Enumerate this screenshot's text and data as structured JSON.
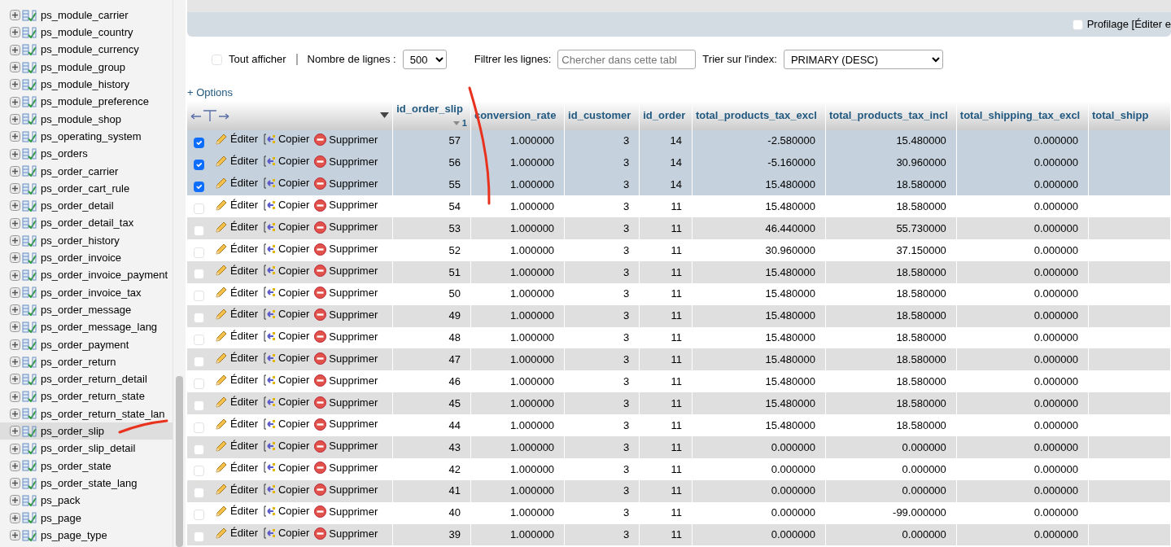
{
  "sidebar": {
    "items": [
      {
        "label": "ps_module_carrier",
        "selected": false
      },
      {
        "label": "ps_module_country",
        "selected": false
      },
      {
        "label": "ps_module_currency",
        "selected": false
      },
      {
        "label": "ps_module_group",
        "selected": false
      },
      {
        "label": "ps_module_history",
        "selected": false
      },
      {
        "label": "ps_module_preference",
        "selected": false
      },
      {
        "label": "ps_module_shop",
        "selected": false
      },
      {
        "label": "ps_operating_system",
        "selected": false
      },
      {
        "label": "ps_orders",
        "selected": false
      },
      {
        "label": "ps_order_carrier",
        "selected": false
      },
      {
        "label": "ps_order_cart_rule",
        "selected": false
      },
      {
        "label": "ps_order_detail",
        "selected": false
      },
      {
        "label": "ps_order_detail_tax",
        "selected": false
      },
      {
        "label": "ps_order_history",
        "selected": false
      },
      {
        "label": "ps_order_invoice",
        "selected": false
      },
      {
        "label": "ps_order_invoice_payment",
        "selected": false
      },
      {
        "label": "ps_order_invoice_tax",
        "selected": false
      },
      {
        "label": "ps_order_message",
        "selected": false
      },
      {
        "label": "ps_order_message_lang",
        "selected": false
      },
      {
        "label": "ps_order_payment",
        "selected": false
      },
      {
        "label": "ps_order_return",
        "selected": false
      },
      {
        "label": "ps_order_return_detail",
        "selected": false
      },
      {
        "label": "ps_order_return_state",
        "selected": false
      },
      {
        "label": "ps_order_return_state_lan",
        "selected": false
      },
      {
        "label": "ps_order_slip",
        "selected": true
      },
      {
        "label": "ps_order_slip_detail",
        "selected": false
      },
      {
        "label": "ps_order_state",
        "selected": false
      },
      {
        "label": "ps_order_state_lang",
        "selected": false
      },
      {
        "label": "ps_pack",
        "selected": false
      },
      {
        "label": "ps_page",
        "selected": false
      },
      {
        "label": "ps_page_type",
        "selected": false
      }
    ]
  },
  "profiling": {
    "checked": false,
    "label": "Profilage [",
    "link": "Éditer e"
  },
  "controls": {
    "show_all": {
      "checked": false,
      "label": "Tout afficher"
    },
    "rows_label": "Nombre de lignes :",
    "rows_value": "500",
    "filter_label": "Filtrer les lignes:",
    "filter_placeholder": "Chercher dans cette tabl",
    "sort_label": "Trier sur l'index:",
    "sort_value": "PRIMARY (DESC)"
  },
  "options_link": "+ Options",
  "table": {
    "columns": [
      {
        "label": "id_order_slip",
        "sort_number": "1"
      },
      {
        "label": "conversion_rate"
      },
      {
        "label": "id_customer"
      },
      {
        "label": "id_order"
      },
      {
        "label": "total_products_tax_excl"
      },
      {
        "label": "total_products_tax_incl"
      },
      {
        "label": "total_shipping_tax_excl"
      },
      {
        "label": "total_shipp"
      }
    ],
    "rows": [
      {
        "selected": true,
        "edit": "Éditer",
        "copy": "Copier",
        "delete": "Supprimer",
        "cells": [
          "57",
          "1.000000",
          "3",
          "14",
          "-2.580000",
          "15.480000",
          "0.000000"
        ]
      },
      {
        "selected": true,
        "edit": "Éditer",
        "copy": "Copier",
        "delete": "Supprimer",
        "cells": [
          "56",
          "1.000000",
          "3",
          "14",
          "-5.160000",
          "30.960000",
          "0.000000"
        ]
      },
      {
        "selected": true,
        "edit": "Éditer",
        "copy": "Copier",
        "delete": "Supprimer",
        "cells": [
          "55",
          "1.000000",
          "3",
          "14",
          "15.480000",
          "18.580000",
          "0.000000"
        ]
      },
      {
        "selected": false,
        "edit": "Éditer",
        "copy": "Copier",
        "delete": "Supprimer",
        "cells": [
          "54",
          "1.000000",
          "3",
          "11",
          "15.480000",
          "18.580000",
          "0.000000"
        ]
      },
      {
        "selected": false,
        "edit": "Éditer",
        "copy": "Copier",
        "delete": "Supprimer",
        "cells": [
          "53",
          "1.000000",
          "3",
          "11",
          "46.440000",
          "55.730000",
          "0.000000"
        ]
      },
      {
        "selected": false,
        "edit": "Éditer",
        "copy": "Copier",
        "delete": "Supprimer",
        "cells": [
          "52",
          "1.000000",
          "3",
          "11",
          "30.960000",
          "37.150000",
          "0.000000"
        ]
      },
      {
        "selected": false,
        "edit": "Éditer",
        "copy": "Copier",
        "delete": "Supprimer",
        "cells": [
          "51",
          "1.000000",
          "3",
          "11",
          "15.480000",
          "18.580000",
          "0.000000"
        ]
      },
      {
        "selected": false,
        "edit": "Éditer",
        "copy": "Copier",
        "delete": "Supprimer",
        "cells": [
          "50",
          "1.000000",
          "3",
          "11",
          "15.480000",
          "18.580000",
          "0.000000"
        ]
      },
      {
        "selected": false,
        "edit": "Éditer",
        "copy": "Copier",
        "delete": "Supprimer",
        "cells": [
          "49",
          "1.000000",
          "3",
          "11",
          "15.480000",
          "18.580000",
          "0.000000"
        ]
      },
      {
        "selected": false,
        "edit": "Éditer",
        "copy": "Copier",
        "delete": "Supprimer",
        "cells": [
          "48",
          "1.000000",
          "3",
          "11",
          "15.480000",
          "18.580000",
          "0.000000"
        ]
      },
      {
        "selected": false,
        "edit": "Éditer",
        "copy": "Copier",
        "delete": "Supprimer",
        "cells": [
          "47",
          "1.000000",
          "3",
          "11",
          "15.480000",
          "18.580000",
          "0.000000"
        ]
      },
      {
        "selected": false,
        "edit": "Éditer",
        "copy": "Copier",
        "delete": "Supprimer",
        "cells": [
          "46",
          "1.000000",
          "3",
          "11",
          "15.480000",
          "18.580000",
          "0.000000"
        ]
      },
      {
        "selected": false,
        "edit": "Éditer",
        "copy": "Copier",
        "delete": "Supprimer",
        "cells": [
          "45",
          "1.000000",
          "3",
          "11",
          "15.480000",
          "18.580000",
          "0.000000"
        ]
      },
      {
        "selected": false,
        "edit": "Éditer",
        "copy": "Copier",
        "delete": "Supprimer",
        "cells": [
          "44",
          "1.000000",
          "3",
          "11",
          "15.480000",
          "18.580000",
          "0.000000"
        ]
      },
      {
        "selected": false,
        "edit": "Éditer",
        "copy": "Copier",
        "delete": "Supprimer",
        "cells": [
          "43",
          "1.000000",
          "3",
          "11",
          "0.000000",
          "0.000000",
          "0.000000"
        ]
      },
      {
        "selected": false,
        "edit": "Éditer",
        "copy": "Copier",
        "delete": "Supprimer",
        "cells": [
          "42",
          "1.000000",
          "3",
          "11",
          "0.000000",
          "0.000000",
          "0.000000"
        ]
      },
      {
        "selected": false,
        "edit": "Éditer",
        "copy": "Copier",
        "delete": "Supprimer",
        "cells": [
          "41",
          "1.000000",
          "3",
          "11",
          "0.000000",
          "0.000000",
          "0.000000"
        ]
      },
      {
        "selected": false,
        "edit": "Éditer",
        "copy": "Copier",
        "delete": "Supprimer",
        "cells": [
          "40",
          "1.000000",
          "3",
          "11",
          "0.000000",
          "-99.000000",
          "0.000000"
        ]
      },
      {
        "selected": false,
        "edit": "Éditer",
        "copy": "Copier",
        "delete": "Supprimer",
        "cells": [
          "39",
          "1.000000",
          "3",
          "11",
          "0.000000",
          "0.000000",
          "0.000000"
        ]
      }
    ]
  }
}
